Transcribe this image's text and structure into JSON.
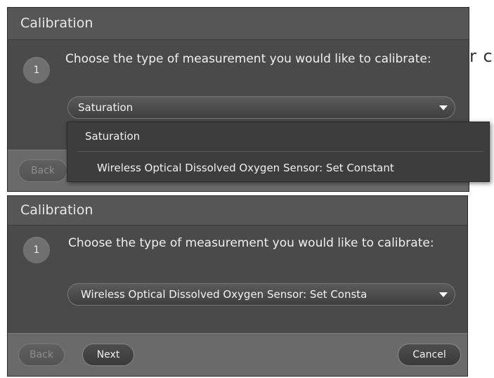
{
  "background_text": "r c",
  "dialog_open": {
    "title": "Calibration",
    "step": {
      "number": "1",
      "text": "Choose the type of measurement you would like to calibrate:"
    },
    "select": {
      "selected": "Saturation"
    },
    "dropdown": {
      "options": [
        "Saturation",
        "Wireless Optical Dissolved Oxygen Sensor: Set Constant"
      ]
    },
    "footer": {
      "back_label": "Back"
    }
  },
  "dialog_closed": {
    "title": "Calibration",
    "step": {
      "number": "1",
      "text": "Choose the type of measurement you would like to calibrate:"
    },
    "select": {
      "selected": "Wireless Optical Dissolved Oxygen Sensor: Set Consta"
    },
    "footer": {
      "back_label": "Back",
      "next_label": "Next",
      "cancel_label": "Cancel"
    }
  },
  "colors": {
    "dialog_bg": "#4a4a4a",
    "titlebar_bg": "#565656",
    "footer_bg": "#6a6a6a",
    "text": "#f0f0f0"
  }
}
